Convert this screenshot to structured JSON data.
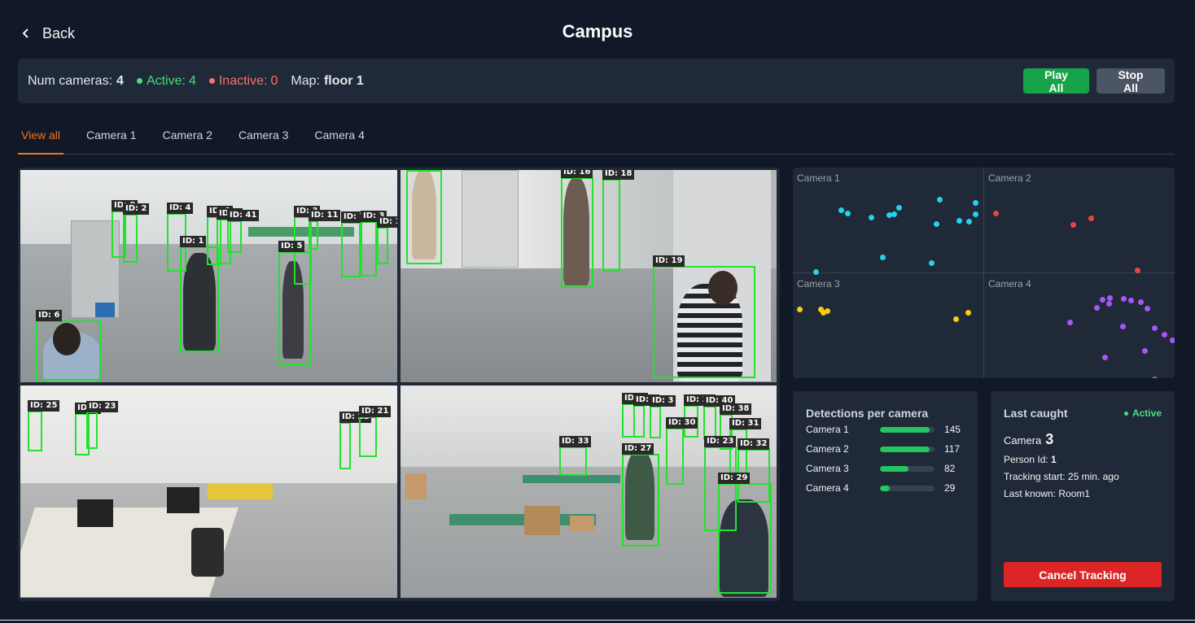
{
  "header": {
    "back_label": "Back",
    "title": "Campus"
  },
  "status": {
    "num_cameras_label": "Num cameras:",
    "num_cameras_value": "4",
    "active_label": "Active:",
    "active_value": "4",
    "inactive_label": "Inactive:",
    "inactive_value": "0",
    "map_label": "Map:",
    "map_value": "floor 1",
    "play_all_label": "Play All",
    "stop_all_label": "Stop All",
    "colors": {
      "active": "#4ade80",
      "inactive": "#f87171",
      "play": "#16a34a",
      "stop": "#4b5563"
    }
  },
  "tabs": [
    {
      "label": "View all",
      "active": true
    },
    {
      "label": "Camera 1",
      "active": false
    },
    {
      "label": "Camera 2",
      "active": false
    },
    {
      "label": "Camera 3",
      "active": false
    },
    {
      "label": "Camera 4",
      "active": false
    }
  ],
  "feeds": {
    "camera1": {
      "ids": [
        "ID: 9",
        "ID: 2",
        "ID: 4",
        "ID: 1",
        "ID: 1",
        "ID: 41",
        "ID: 3",
        "ID: 11",
        "ID: 7",
        "ID: 3",
        "ID: 1",
        "ID: 5",
        "ID: 6"
      ]
    },
    "camera2": {
      "ids": [
        "ID: 16",
        "ID: 18",
        "ID: 19"
      ]
    },
    "camera3": {
      "ids": [
        "ID: 25",
        "ID: 1",
        "ID: 23",
        "ID: 22",
        "ID: 21"
      ]
    },
    "camera4": {
      "ids": [
        "ID: 3",
        "ID: 3",
        "ID: 3",
        "ID: 39",
        "ID: 40",
        "ID: 38",
        "ID: 30",
        "ID: 31",
        "ID: 33",
        "ID: 27",
        "ID: 23",
        "ID: 32",
        "ID: 29"
      ]
    }
  },
  "map": {
    "quadrants": [
      {
        "label": "Camera 1",
        "color": "#22d3ee"
      },
      {
        "label": "Camera 2",
        "color": "#ef4444"
      },
      {
        "label": "Camera 3",
        "color": "#facc15"
      },
      {
        "label": "Camera 4",
        "color": "#a855f7"
      }
    ]
  },
  "detections": {
    "title": "Detections per camera",
    "rows": [
      {
        "name": "Camera 1",
        "value": "145",
        "fraction": 0.91
      },
      {
        "name": "Camera 2",
        "value": "117",
        "fraction": 0.91
      },
      {
        "name": "Camera 3",
        "value": "82",
        "fraction": 0.52
      },
      {
        "name": "Camera 4",
        "value": "29",
        "fraction": 0.19
      }
    ]
  },
  "last_caught": {
    "title": "Last caught",
    "status": "Active",
    "camera_label": "Camera",
    "camera_value": "3",
    "person_id_label": "Person Id:",
    "person_id_value": "1",
    "tracking_start": "Tracking start: 25 min. ago",
    "last_known": "Last known: Room1",
    "cancel_label": "Cancel Tracking"
  }
}
